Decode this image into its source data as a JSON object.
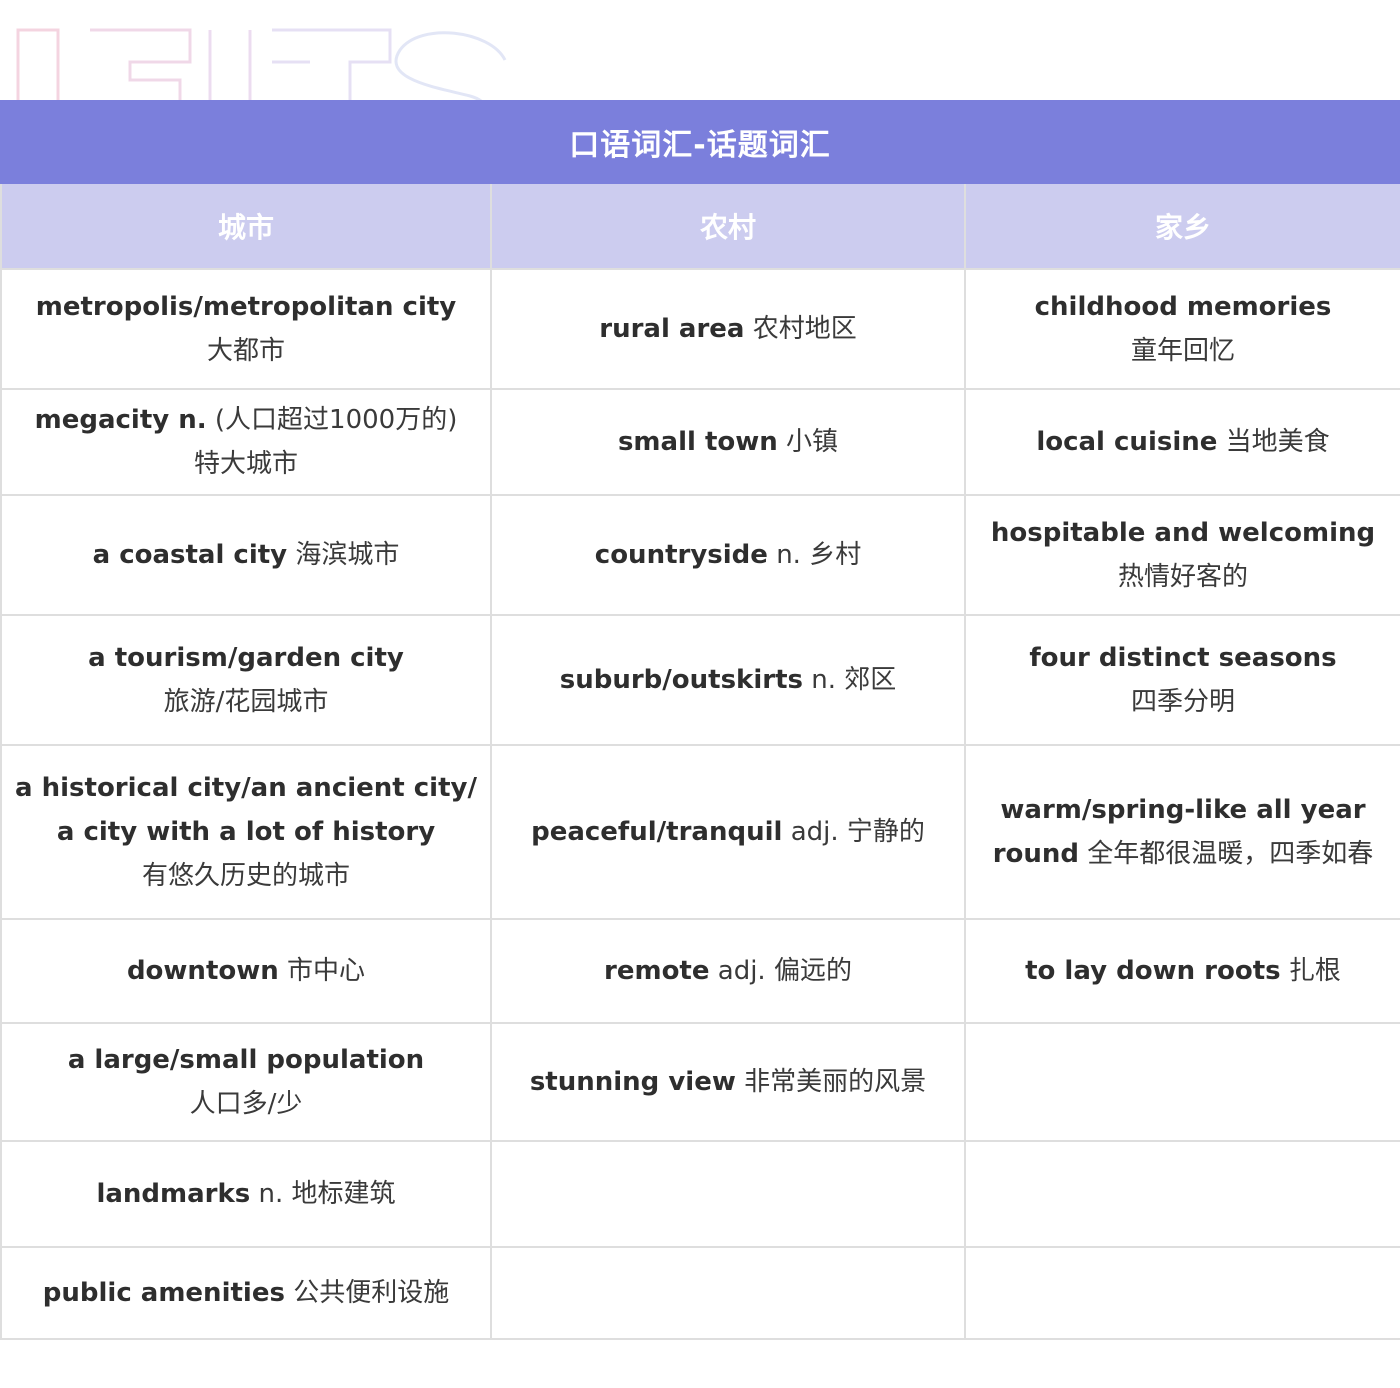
{
  "watermark_text": "IELTS",
  "title": "口语词汇-话题词汇",
  "columns": [
    "城市",
    "农村",
    "家乡"
  ],
  "rows": [
    [
      {
        "en": "metropolis/metropolitan city",
        "cn": "大都市",
        "layout": "stack"
      },
      {
        "en": "rural area",
        "cn": "农村地区",
        "layout": "inline"
      },
      {
        "en": "childhood memories",
        "cn": "童年回忆",
        "layout": "stack"
      }
    ],
    [
      {
        "en": "megacity n.",
        "cn": "(人口超过1000万的)",
        "cn2": "特大城市",
        "layout": "inline2"
      },
      {
        "en": "small town",
        "cn": "小镇",
        "layout": "inline"
      },
      {
        "en": "local cuisine",
        "cn": "当地美食",
        "layout": "inline"
      }
    ],
    [
      {
        "en": "a coastal city",
        "cn": "海滨城市",
        "layout": "inline"
      },
      {
        "en": "countryside",
        "cn": "n. 乡村",
        "layout": "inline"
      },
      {
        "en": "hospitable and welcoming",
        "cn": "热情好客的",
        "layout": "stack"
      }
    ],
    [
      {
        "en": "a tourism/garden city",
        "cn": "旅游/花园城市",
        "layout": "stack"
      },
      {
        "en": "suburb/outskirts",
        "cn": "n. 郊区",
        "layout": "inline"
      },
      {
        "en": "four distinct seasons",
        "cn": "四季分明",
        "layout": "stack"
      }
    ],
    [
      {
        "en": "a historical city/an ancient city/",
        "en2": "a city with a lot of history",
        "cn": "有悠久历史的城市",
        "layout": "stack2"
      },
      {
        "en": "peaceful/tranquil",
        "cn": "adj. 宁静的",
        "layout": "inline"
      },
      {
        "en": "warm/spring-like all year",
        "en2": "round",
        "cn": "全年都很温暖，四季如春",
        "layout": "wrap"
      }
    ],
    [
      {
        "en": "downtown",
        "cn": "市中心",
        "layout": "inline"
      },
      {
        "en": "remote",
        "cn": "adj. 偏远的",
        "layout": "inline"
      },
      {
        "en": "to lay down roots",
        "cn": "扎根",
        "layout": "inline"
      }
    ],
    [
      {
        "en": "a large/small population",
        "cn": "人口多/少",
        "layout": "stack"
      },
      {
        "en": "stunning view",
        "cn": "非常美丽的风景",
        "layout": "inline"
      },
      {
        "en": "",
        "cn": "",
        "layout": "empty"
      }
    ],
    [
      {
        "en": "landmarks",
        "cn": "n. 地标建筑",
        "layout": "inline"
      },
      {
        "en": "",
        "cn": "",
        "layout": "empty"
      },
      {
        "en": "",
        "cn": "",
        "layout": "empty"
      }
    ],
    [
      {
        "en": "public amenities",
        "cn": "公共便利设施",
        "layout": "inline"
      },
      {
        "en": "",
        "cn": "",
        "layout": "empty"
      },
      {
        "en": "",
        "cn": "",
        "layout": "empty"
      }
    ]
  ]
}
